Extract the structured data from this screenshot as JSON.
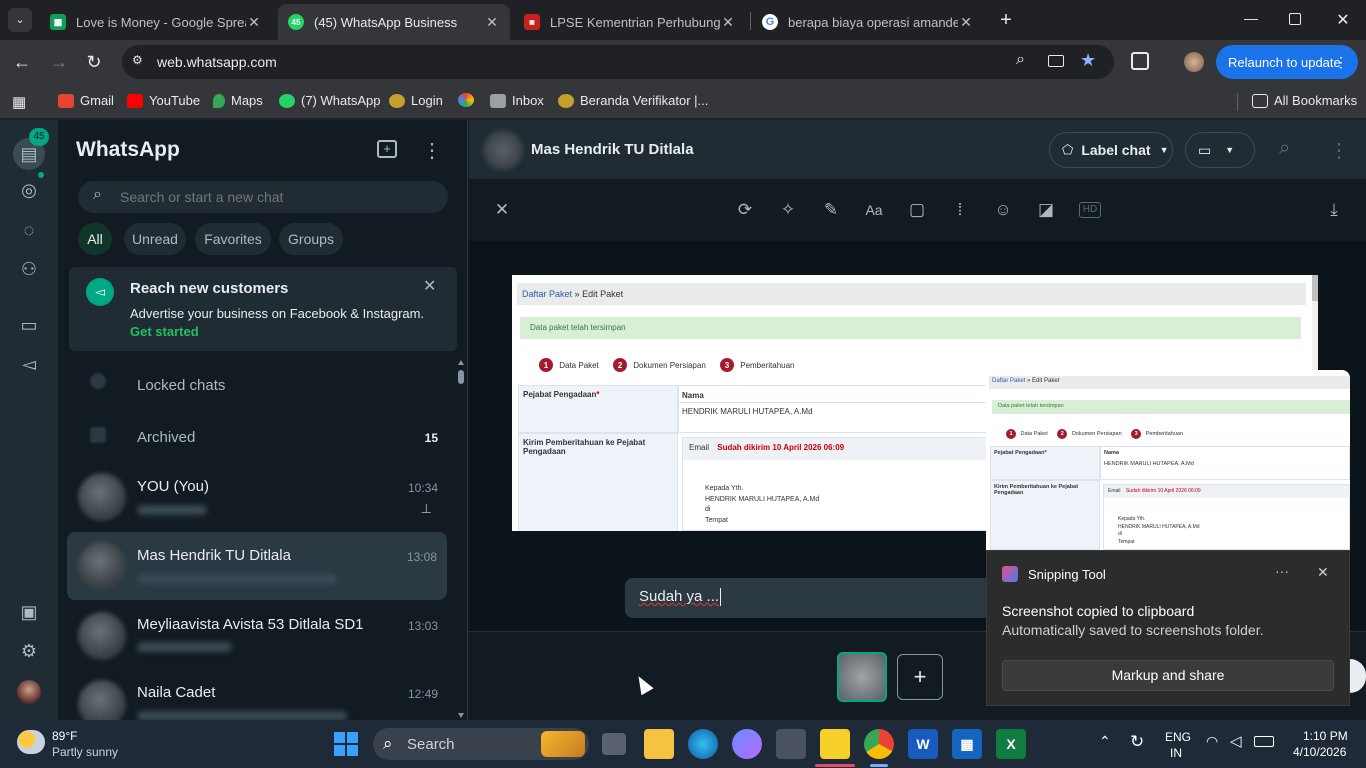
{
  "browser": {
    "tabs": [
      {
        "title": "Love is Money - Google Spread",
        "color": "#0f9d58",
        "active": false
      },
      {
        "title": "(45) WhatsApp Business",
        "color": "#25d366",
        "active": true,
        "badge": "45"
      },
      {
        "title": "LPSE Kementrian Perhubungan",
        "color": "#c5221f",
        "active": false
      },
      {
        "title": "berapa biaya operasi amandel",
        "color": "#ffffff",
        "active": false
      }
    ],
    "url": "web.whatsapp.com",
    "relaunch_label": "Relaunch to update",
    "bookmarks": [
      {
        "label": "Gmail",
        "color": "#ea4335"
      },
      {
        "label": "YouTube",
        "color": "#ff0000"
      },
      {
        "label": "Maps",
        "color": "#34a853"
      },
      {
        "label": "(7) WhatsApp",
        "color": "#25d366"
      },
      {
        "label": "Login",
        "color": "#c5a02e"
      },
      {
        "label": "Inbox",
        "color": "#9aa0a6"
      },
      {
        "label": "Beranda Verifikator |...",
        "color": "#c5a02e"
      }
    ],
    "all_bookmarks_label": "All Bookmarks"
  },
  "whatsapp": {
    "nav_badge": "45",
    "title": "WhatsApp",
    "search_placeholder": "Search or start a new chat",
    "filters": [
      "All",
      "Unread",
      "Favorites",
      "Groups"
    ],
    "promo": {
      "title": "Reach new customers",
      "text": "Advertise your business on Facebook & Instagram.",
      "link": "Get started"
    },
    "locked_label": "Locked chats",
    "archived_label": "Archived",
    "archived_count": "15",
    "chats": [
      {
        "name": "YOU (You)",
        "time": "10:34"
      },
      {
        "name": "Mas Hendrik TU Ditlala",
        "time": "13:08"
      },
      {
        "name": "Meyliaavista Avista 53 Ditlala SD1",
        "time": "13:03"
      },
      {
        "name": "Naila Cadet",
        "time": "12:49"
      }
    ],
    "open_chat": {
      "name": "Mas Hendrik TU Ditlala",
      "label_chat": "Label chat",
      "caption": "Sudah ya ..."
    }
  },
  "document_preview": {
    "breadcrumb_link": "Daftar Paket",
    "breadcrumb_sep": "»",
    "breadcrumb_current": "Edit Paket",
    "success_msg": "Data paket telah tersimpan",
    "steps": [
      {
        "n": "1",
        "label": "Data Paket"
      },
      {
        "n": "2",
        "label": "Dokumen Persiapan"
      },
      {
        "n": "3",
        "label": "Pemberitahuan"
      }
    ],
    "pejabat_label": "Pejabat Pengadaan",
    "required_mark": "*",
    "nama_header": "Nama",
    "nama_value": "HENDRIK MARULI HUTAPEA, A.Md",
    "kirim_label": "Kirim Pemberitahuan ke Pejabat Pengadaan",
    "email_label": "Email",
    "email_status": "Sudah dikirim 10 April 2026 06:09",
    "letter_lines": [
      "Kepada Yth.",
      "HENDRIK MARULI HUTAPEA, A.Md",
      "di",
      "Tempat"
    ]
  },
  "snipping": {
    "app_name": "Snipping Tool",
    "title": "Screenshot copied to clipboard",
    "subtitle": "Automatically saved to screenshots folder.",
    "action": "Markup and share"
  },
  "taskbar": {
    "weather_temp": "89°F",
    "weather_desc": "Partly sunny",
    "search_label": "Search",
    "lang_top": "ENG",
    "lang_bottom": "IN",
    "time": "1:10 PM",
    "date": "4/10/2026"
  }
}
